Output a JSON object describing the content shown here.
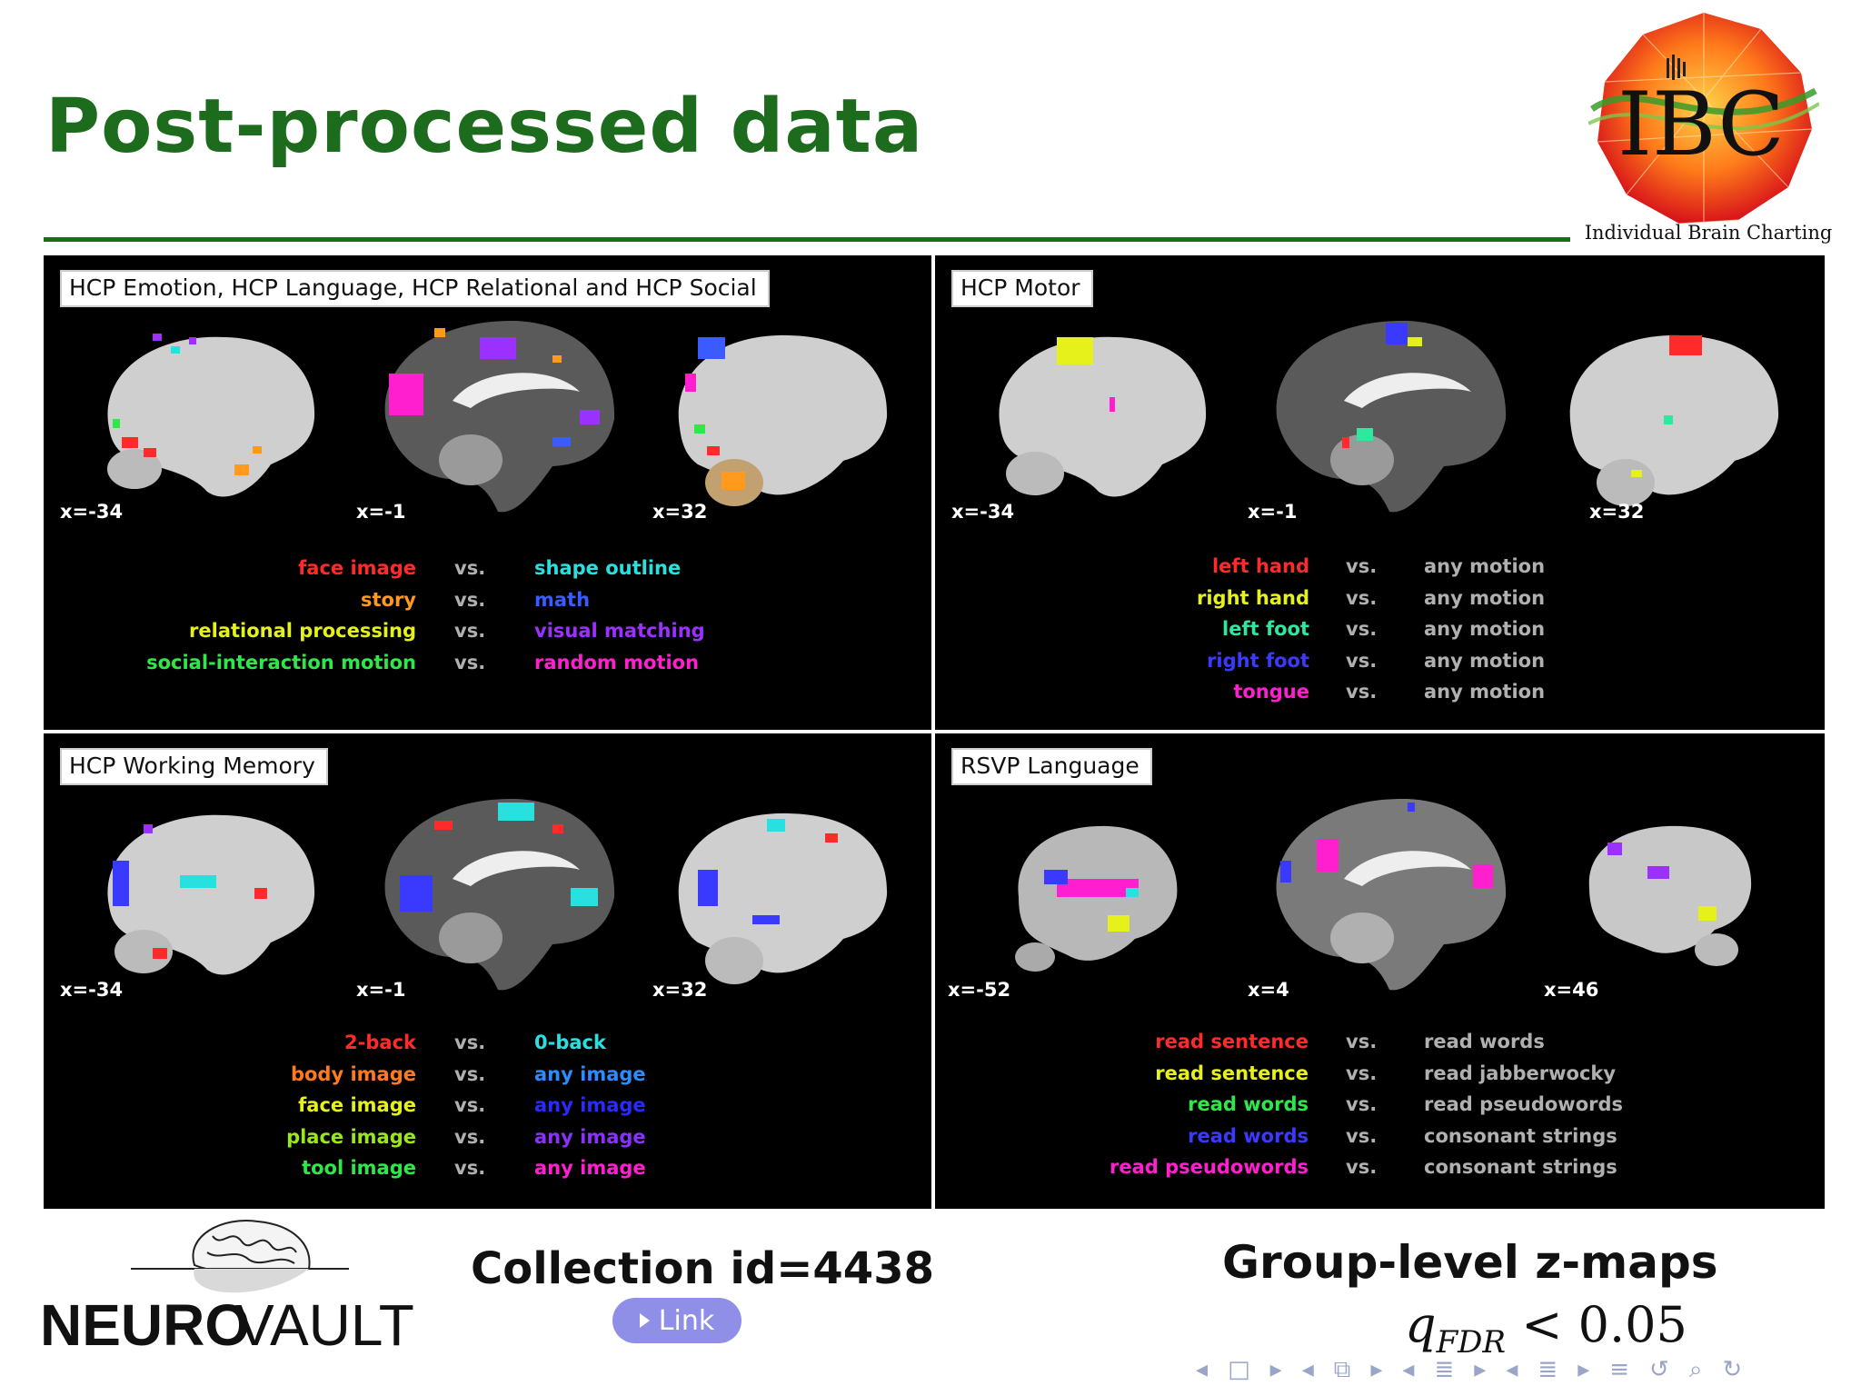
{
  "slide": {
    "title": "Post-processed data",
    "logo_caption": "Individual Brain Charting",
    "logo_letters": "IBC"
  },
  "panels": [
    {
      "title": "HCP Emotion,  HCP Language,  HCP Relational and HCP Social",
      "coords": [
        "x=-34",
        "x=-1",
        "x=32"
      ],
      "vs_label": "vs.",
      "rows": [
        {
          "left": "face image",
          "left_color": "#ff2a2a",
          "right": "shape outline",
          "right_color": "#29e0e0"
        },
        {
          "left": "story",
          "left_color": "#ff9a1f",
          "right": "math",
          "right_color": "#3a5bff"
        },
        {
          "left": "relational processing",
          "left_color": "#e6f01a",
          "right": "visual matching",
          "right_color": "#9b30ff"
        },
        {
          "left": "social-interaction motion",
          "left_color": "#2ee84a",
          "right": "random motion",
          "right_color": "#ff1fcf"
        }
      ]
    },
    {
      "title": "HCP Motor",
      "coords": [
        "x=-34",
        "x=-1",
        "x=32"
      ],
      "vs_label": "vs.",
      "rows": [
        {
          "left": "left hand",
          "left_color": "#ff2a2a",
          "right": "any motion",
          "right_color": "#b0b0b0"
        },
        {
          "left": "right hand",
          "left_color": "#e6f01a",
          "right": "any motion",
          "right_color": "#b0b0b0"
        },
        {
          "left": "left foot",
          "left_color": "#2ee8a0",
          "right": "any motion",
          "right_color": "#b0b0b0"
        },
        {
          "left": "right foot",
          "left_color": "#3a3aff",
          "right": "any motion",
          "right_color": "#b0b0b0"
        },
        {
          "left": "tongue",
          "left_color": "#ff1fcf",
          "right": "any motion",
          "right_color": "#b0b0b0"
        }
      ]
    },
    {
      "title": "HCP Working Memory",
      "coords": [
        "x=-34",
        "x=-1",
        "x=32"
      ],
      "vs_label": "vs.",
      "rows": [
        {
          "left": "2-back",
          "left_color": "#ff2a2a",
          "right": "0-back",
          "right_color": "#29e0e0"
        },
        {
          "left": "body image",
          "left_color": "#ff7a1f",
          "right": "any image",
          "right_color": "#2a8cff"
        },
        {
          "left": "face image",
          "left_color": "#e6f01a",
          "right": "any image",
          "right_color": "#2a2aff"
        },
        {
          "left": "place image",
          "left_color": "#9be81a",
          "right": "any image",
          "right_color": "#8a30ff"
        },
        {
          "left": "tool image",
          "left_color": "#2ee84a",
          "right": "any image",
          "right_color": "#ff1fcf"
        }
      ]
    },
    {
      "title": "RSVP Language",
      "coords": [
        "x=-52",
        "x=4",
        "x=46"
      ],
      "vs_label": "vs.",
      "rows": [
        {
          "left": "read sentence",
          "left_color": "#ff2a2a",
          "right": "read words",
          "right_color": "#b0b0b0"
        },
        {
          "left": "read sentence",
          "left_color": "#e6f01a",
          "right": "read jabberwocky",
          "right_color": "#b0b0b0"
        },
        {
          "left": "read words",
          "left_color": "#2ee84a",
          "right": "read pseudowords",
          "right_color": "#b0b0b0"
        },
        {
          "left": "read words",
          "left_color": "#3a3aff",
          "right": "consonant strings",
          "right_color": "#b0b0b0"
        },
        {
          "left": "read pseudowords",
          "left_color": "#ff1fcf",
          "right": "consonant strings",
          "right_color": "#b0b0b0"
        }
      ]
    }
  ],
  "footer": {
    "neurovault_bold": "NEURO",
    "neurovault_light": "VAULT",
    "collection": "Collection id=4438",
    "link_label": "Link",
    "group_title": "Group-level z-maps",
    "q_symbol": "q",
    "q_sub": "FDR",
    "q_rest": " < 0.05"
  },
  "nav_icons": [
    "arrow-left",
    "frame",
    "arrow-right",
    "arrow-left",
    "subsection",
    "arrow-right",
    "arrow-left",
    "section",
    "arrow-right",
    "arrow-left",
    "slide",
    "arrow-right",
    "align",
    "undo",
    "search",
    "redo"
  ]
}
